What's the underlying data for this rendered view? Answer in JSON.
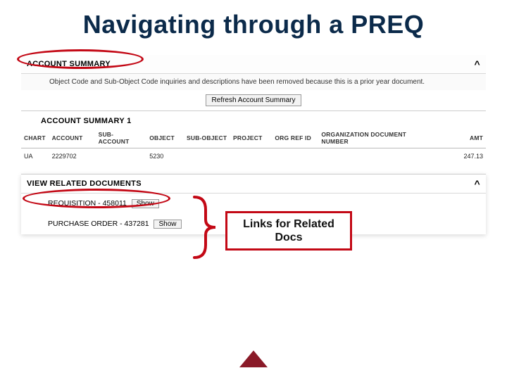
{
  "title": "Navigating through a PREQ",
  "accountSummary": {
    "header": "ACCOUNT SUMMARY",
    "caret": "^",
    "notice": "Object Code and Sub-Object Code inquiries and descriptions have been removed because this is a prior year document.",
    "refreshLabel": "Refresh Account Summary",
    "subTitle": "ACCOUNT SUMMARY 1",
    "columns": [
      "CHART",
      "ACCOUNT",
      "SUB-ACCOUNT",
      "OBJECT",
      "SUB-OBJECT",
      "PROJECT",
      "ORG REF ID",
      "ORGANIZATION DOCUMENT NUMBER",
      "AMT"
    ],
    "rows": [
      {
        "chart": "UA",
        "account": "2229702",
        "subAccount": "",
        "object": "5230",
        "subObject": "",
        "project": "",
        "orgRefId": "",
        "orgDocNum": "",
        "amt": "247.13"
      }
    ]
  },
  "relatedDocs": {
    "header": "VIEW RELATED DOCUMENTS",
    "caret": "^",
    "items": [
      {
        "label": "REQUISITION - 458011",
        "button": "Show"
      },
      {
        "label": "PURCHASE ORDER - 437281",
        "button": "Show"
      }
    ]
  },
  "annotation": {
    "calloutLine1": "Links for Related",
    "calloutLine2": "Docs"
  },
  "colors": {
    "titleNavy": "#0b2a4a",
    "annotationRed": "#c30815",
    "footerMaroon": "#8a1a28"
  },
  "icons": {
    "caretUp": "chevron-up-icon"
  }
}
